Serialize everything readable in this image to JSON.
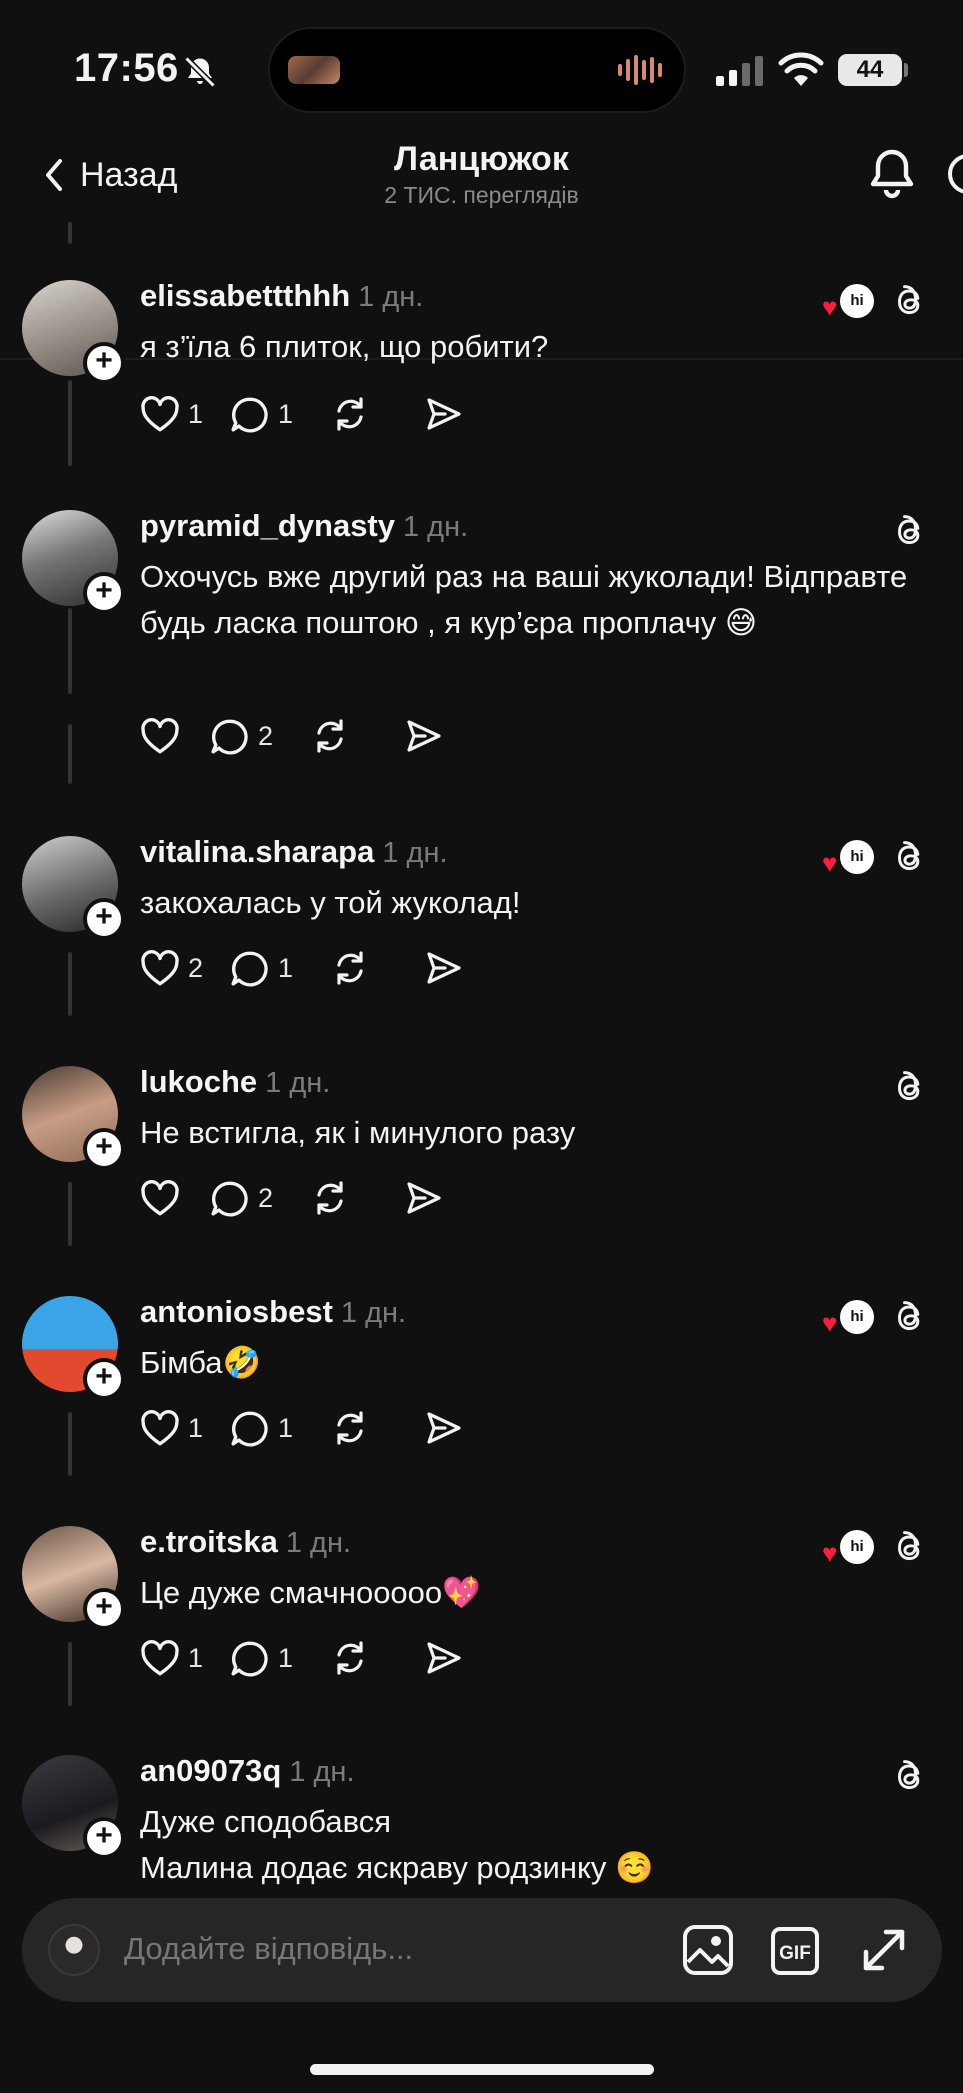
{
  "status_bar": {
    "time": "17:56",
    "battery": "44",
    "icons": [
      "bell-slash-icon",
      "signal-icon",
      "wifi-icon",
      "battery-icon"
    ]
  },
  "nav": {
    "back_label": "Назад",
    "title": "Ланцюжок",
    "subtitle": "2 ТИС. переглядів"
  },
  "comments": [
    {
      "user": "elissabettthhh",
      "time": "1 дн.",
      "text": "я з’їла 6 плиток, що робити?",
      "likes": "1",
      "replies": "1",
      "reaction": true,
      "avatar_bg": "linear-gradient(160deg,#d9d4cf,#8f8780 60%,#5c5651)"
    },
    {
      "user": "pyramid_dynasty",
      "time": "1 дн.",
      "text": "Охочусь вже другий раз на ваші жуколади! Відправте будь ласка поштою , я кур’єра проплачу 😅",
      "likes": "",
      "replies": "2",
      "reaction": false,
      "avatar_bg": "linear-gradient(160deg,#e0e0e0,#777 45%,#2d2d2d)"
    },
    {
      "user": "vitalina.sharapa",
      "time": "1 дн.",
      "text": "закохалась у той жуколад!",
      "likes": "2",
      "replies": "1",
      "reaction": true,
      "avatar_bg": "linear-gradient(160deg,#cfcfcf,#6a6a6a 55%,#262626)"
    },
    {
      "user": "lukoche",
      "time": "1 дн.",
      "text": "Не встигла, як і минулого разу",
      "likes": "",
      "replies": "2",
      "reaction": false,
      "avatar_bg": "linear-gradient(160deg,#4a3a30,#c89d85 50%,#8e6b58)"
    },
    {
      "user": "antoniosbest",
      "time": "1 дн.",
      "text": "Бімба🤣",
      "likes": "1",
      "replies": "1",
      "reaction": true,
      "avatar_bg": "linear-gradient(180deg,#3aa5e6 0 55%,#e14a2f 56% 100%)"
    },
    {
      "user": "e.troitska",
      "time": "1 дн.",
      "text": "Це дуже смачноoooo💖",
      "likes": "1",
      "replies": "1",
      "reaction": true,
      "avatar_bg": "linear-gradient(160deg,#6b5446,#d9b8a2 50%,#3b2c25)"
    },
    {
      "user": "an09073q",
      "time": "1 дн.",
      "text": "Дуже сподобався\nМалина додає яскраву родзинку ☺️",
      "likes": "",
      "replies": "",
      "reaction": false,
      "avatar_bg": "linear-gradient(160deg,#3a3a40,#1b1b1f 60%,#6a5d58)"
    }
  ],
  "reaction_badge": "hi",
  "reply_bar": {
    "placeholder": "Додайте відповідь...",
    "gif_label": "GIF"
  }
}
